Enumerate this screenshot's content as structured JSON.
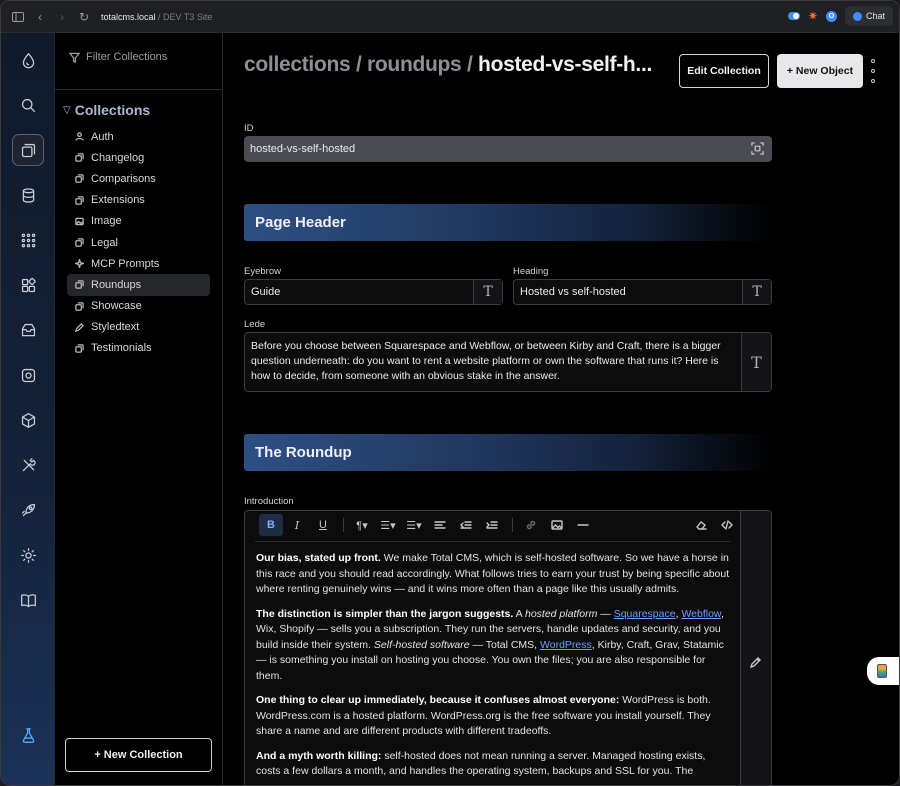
{
  "titlebar": {
    "host": "totalcms.local",
    "site": " / DEV T3 Site",
    "chat_label": "Chat"
  },
  "rail": {
    "icons": [
      "drop-icon",
      "search-icon",
      "collections-icon",
      "database-icon",
      "grid-dots-icon",
      "blocks-icon",
      "inbox-icon",
      "settings-gear-icon",
      "package-icon",
      "tools-icon",
      "rocket-icon",
      "gear-icon",
      "book-icon",
      "flask-icon"
    ]
  },
  "sidebar": {
    "filter_placeholder": "Filter Collections",
    "section_title": "Collections",
    "items": [
      {
        "label": "Auth",
        "icon": "user-icon"
      },
      {
        "label": "Changelog",
        "icon": "copy-icon"
      },
      {
        "label": "Comparisons",
        "icon": "copy-icon"
      },
      {
        "label": "Extensions",
        "icon": "copy-icon"
      },
      {
        "label": "Image",
        "icon": "image-icon"
      },
      {
        "label": "Legal",
        "icon": "copy-icon"
      },
      {
        "label": "MCP Prompts",
        "icon": "sparkle-icon"
      },
      {
        "label": "Roundups",
        "icon": "copy-icon"
      },
      {
        "label": "Showcase",
        "icon": "copy-icon"
      },
      {
        "label": "Styledtext",
        "icon": "pen-icon"
      },
      {
        "label": "Testimonials",
        "icon": "copy-icon"
      }
    ],
    "active_item": "Roundups",
    "new_collection_label": "+ New Collection"
  },
  "header": {
    "crumb_1": "collections",
    "crumb_2": "roundups",
    "crumb_current": "hosted-vs-self-h...",
    "separator": " / ",
    "edit_label": "Edit Collection",
    "new_label": "+ New Object"
  },
  "form": {
    "id_label": "ID",
    "id_value": "hosted-vs-self-hosted",
    "section_page_header": "Page Header",
    "eyebrow_label": "Eyebrow",
    "eyebrow_value": "Guide",
    "heading_label": "Heading",
    "heading_value": "Hosted vs self-hosted",
    "lede_label": "Lede",
    "lede_value": "Before you choose between Squarespace and Webflow, or between Kirby and Craft, there is a bigger question underneath: do you want to rent a website platform or own the software that runs it? Here is how to decide, from someone with an obvious stake in the answer.",
    "section_roundup": "The Roundup",
    "intro_label": "Introduction",
    "text_icon_glyph": "T"
  },
  "editor": {
    "toolbar": {
      "bold": "B",
      "italic": "I",
      "underline": "U",
      "paragraph": "¶▾",
      "bullets": "☰▾",
      "numbers": "☰▾"
    },
    "p1_lead": "Our bias, stated up front.",
    "p1_rest": " We make Total CMS, which is self-hosted software. So we have a horse in this race and you should read accordingly. What follows tries to earn your trust by being specific about where renting genuinely wins — and it wins more often than a page like this usually admits.",
    "p2_lead": "The distinction is simpler than the jargon suggests.",
    "p2_a": " A ",
    "p2_em1": "hosted platform",
    "p2_b": " — ",
    "p2_link1": "Squarespace",
    "p2_c": ", ",
    "p2_link2": "Webflow",
    "p2_d": ", Wix, Shopify — sells you a subscription. They run the servers, handle updates and security, and you build inside their system. ",
    "p2_em2": "Self-hosted software",
    "p2_e": " — Total CMS, ",
    "p2_link3": "WordPress",
    "p2_f": ", Kirby, Craft, Grav, Statamic — is something you install on hosting you choose. You own the files; you are also responsible for them.",
    "p3_lead": "One thing to clear up immediately, because it confuses almost everyone:",
    "p3_rest": " WordPress is both. WordPress.com is a hosted platform. WordPress.org is the free software you install yourself. They share a name and are different products with different tradeoffs.",
    "p4_lead": "And a myth worth killing:",
    "p4_rest": " self-hosted does not mean running a server. Managed hosting exists, costs a few dollars a month, and handles the operating system, backups and SSL for you. The"
  },
  "colors": {
    "accent": "#3d8dff",
    "banner": "#2e4f84",
    "link": "#6da0ff"
  }
}
